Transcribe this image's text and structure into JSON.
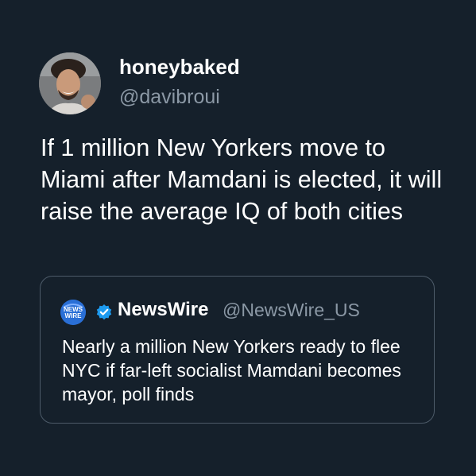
{
  "tweet": {
    "author": {
      "display_name": "honeybaked",
      "handle": "@davibroui",
      "avatar_icon": "profile-photo"
    },
    "text": "If 1 million New Yorkers move to Miami after Mamdani is elected, it will raise the average IQ of both cities"
  },
  "quoted_tweet": {
    "logo_icon": "newswire-logo",
    "logo_text_line1": "NEWS",
    "logo_text_line2": "WIRE",
    "verified_icon": "verified-badge-icon",
    "display_name": "NewsWire",
    "handle": "@NewsWire_US",
    "text": "Nearly a million New Yorkers ready to flee NYC if far-left socialist Mamdani becomes mayor, poll finds"
  },
  "colors": {
    "background": "#15202b",
    "primary_text": "#ffffff",
    "secondary_text": "#8b98a5",
    "card_border": "#4d5b69",
    "verified_blue": "#1d9bf0"
  }
}
